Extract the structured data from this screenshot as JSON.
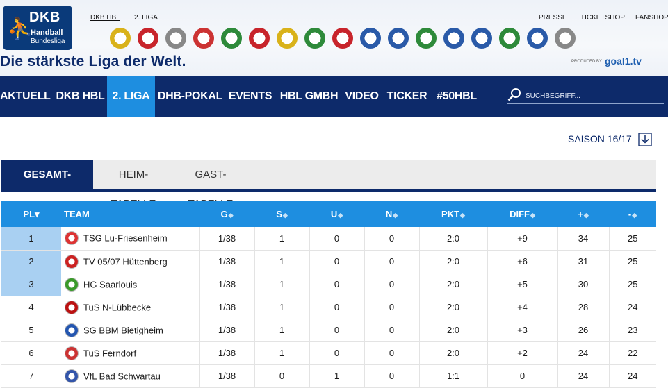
{
  "header": {
    "logo": {
      "title": "DKB",
      "line1": "Handball",
      "line2": "Bundesliga"
    },
    "slogan": "Die stärkste Liga der Welt.",
    "league_links": [
      "DKB HBL",
      "2. LIGA"
    ],
    "utility_links": [
      "PRESSE",
      "TICKETSHOP",
      "FANSHOP"
    ],
    "produced_by": "PRODUCED BY",
    "producer_logo": "goal1.tv",
    "club_logos": [
      "gold",
      "red",
      "grey",
      "red-white",
      "green",
      "red",
      "gold",
      "green",
      "red",
      "blue",
      "blue",
      "green",
      "blue",
      "blue",
      "green",
      "blue",
      "grey"
    ]
  },
  "nav": {
    "items": [
      "AKTUELL",
      "DKB HBL",
      "2. LIGA",
      "DHB-POKAL",
      "EVENTS",
      "HBL GMBH",
      "VIDEO",
      "TICKER",
      "#50HBL"
    ],
    "active": "2. LIGA",
    "search_placeholder": "SUCHBEGRIFF..."
  },
  "season": {
    "label": "SAISON 16/17"
  },
  "tabs": {
    "items": [
      "GESAMT-TABELLE",
      "HEIM-TABELLE",
      "GAST-TABELLE"
    ],
    "active": "GESAMT-TABELLE"
  },
  "table": {
    "columns": [
      "PL▾",
      "TEAM",
      "G",
      "S",
      "U",
      "N",
      "PKT",
      "DIFF",
      "+",
      "-"
    ],
    "rows": [
      {
        "pl": "1",
        "team": "TSG Lu-Friesenheim",
        "g": "1/38",
        "s": "1",
        "u": "0",
        "n": "0",
        "pkt": "2:0",
        "diff": "+9",
        "plus": "34",
        "minus": "25",
        "color": "#d33",
        "highlight": true
      },
      {
        "pl": "2",
        "team": "TV 05/07 Hüttenberg",
        "g": "1/38",
        "s": "1",
        "u": "0",
        "n": "0",
        "pkt": "2:0",
        "diff": "+6",
        "plus": "31",
        "minus": "25",
        "color": "#c22",
        "highlight": true
      },
      {
        "pl": "3",
        "team": "HG Saarlouis",
        "g": "1/38",
        "s": "1",
        "u": "0",
        "n": "0",
        "pkt": "2:0",
        "diff": "+5",
        "plus": "30",
        "minus": "25",
        "color": "#3a9a2a",
        "highlight": true
      },
      {
        "pl": "4",
        "team": "TuS N-Lübbecke",
        "g": "1/38",
        "s": "1",
        "u": "0",
        "n": "0",
        "pkt": "2:0",
        "diff": "+4",
        "plus": "28",
        "minus": "24",
        "color": "#b11",
        "highlight": false
      },
      {
        "pl": "5",
        "team": "SG BBM Bietigheim",
        "g": "1/38",
        "s": "1",
        "u": "0",
        "n": "0",
        "pkt": "2:0",
        "diff": "+3",
        "plus": "26",
        "minus": "23",
        "color": "#2456b0",
        "highlight": false
      },
      {
        "pl": "6",
        "team": "TuS Ferndorf",
        "g": "1/38",
        "s": "1",
        "u": "0",
        "n": "0",
        "pkt": "2:0",
        "diff": "+2",
        "plus": "24",
        "minus": "22",
        "color": "#c33",
        "highlight": false
      },
      {
        "pl": "7",
        "team": "VfL Bad Schwartau",
        "g": "1/38",
        "s": "0",
        "u": "1",
        "n": "0",
        "pkt": "1:1",
        "diff": "0",
        "plus": "24",
        "minus": "24",
        "color": "#3355aa",
        "highlight": false
      }
    ]
  }
}
